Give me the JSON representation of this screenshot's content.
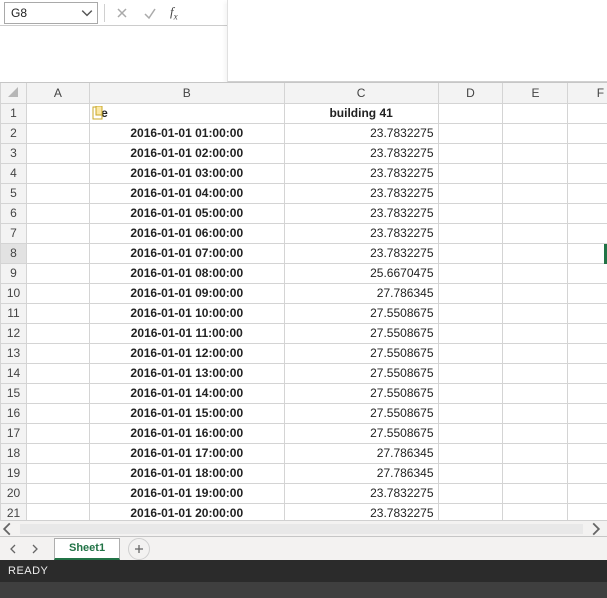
{
  "namebox": {
    "value": "G8"
  },
  "formula": {
    "value": ""
  },
  "sheet": {
    "name": "Sheet1",
    "columns": [
      "A",
      "B",
      "C",
      "D",
      "E",
      "F"
    ],
    "b1_text": "ne",
    "c1_text": "building 41",
    "rows": [
      {
        "n": 2,
        "b": "2016-01-01 01:00:00",
        "c": "23.7832275"
      },
      {
        "n": 3,
        "b": "2016-01-01 02:00:00",
        "c": "23.7832275"
      },
      {
        "n": 4,
        "b": "2016-01-01 03:00:00",
        "c": "23.7832275"
      },
      {
        "n": 5,
        "b": "2016-01-01 04:00:00",
        "c": "23.7832275"
      },
      {
        "n": 6,
        "b": "2016-01-01 05:00:00",
        "c": "23.7832275"
      },
      {
        "n": 7,
        "b": "2016-01-01 06:00:00",
        "c": "23.7832275"
      },
      {
        "n": 8,
        "b": "2016-01-01 07:00:00",
        "c": "23.7832275"
      },
      {
        "n": 9,
        "b": "2016-01-01 08:00:00",
        "c": "25.6670475"
      },
      {
        "n": 10,
        "b": "2016-01-01 09:00:00",
        "c": "27.786345"
      },
      {
        "n": 11,
        "b": "2016-01-01 10:00:00",
        "c": "27.5508675"
      },
      {
        "n": 12,
        "b": "2016-01-01 11:00:00",
        "c": "27.5508675"
      },
      {
        "n": 13,
        "b": "2016-01-01 12:00:00",
        "c": "27.5508675"
      },
      {
        "n": 14,
        "b": "2016-01-01 13:00:00",
        "c": "27.5508675"
      },
      {
        "n": 15,
        "b": "2016-01-01 14:00:00",
        "c": "27.5508675"
      },
      {
        "n": 16,
        "b": "2016-01-01 15:00:00",
        "c": "27.5508675"
      },
      {
        "n": 17,
        "b": "2016-01-01 16:00:00",
        "c": "27.5508675"
      },
      {
        "n": 18,
        "b": "2016-01-01 17:00:00",
        "c": "27.786345"
      },
      {
        "n": 19,
        "b": "2016-01-01 18:00:00",
        "c": "27.786345"
      },
      {
        "n": 20,
        "b": "2016-01-01 19:00:00",
        "c": "23.7832275"
      },
      {
        "n": 21,
        "b": "2016-01-01 20:00:00",
        "c": "23.7832275"
      }
    ]
  },
  "status": {
    "text": "READY"
  }
}
